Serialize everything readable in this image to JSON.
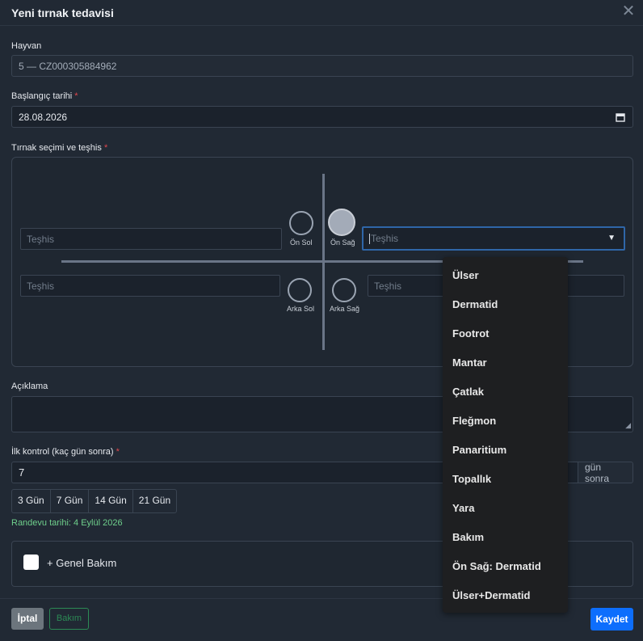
{
  "modal": {
    "title": "Yeni tırnak tedavisi",
    "close": "✕"
  },
  "animal": {
    "label": "Hayvan",
    "value": "5 — CZ000305884962"
  },
  "start_date": {
    "label": "Başlangıç tarihi",
    "required": "*",
    "value": "28.08.2026"
  },
  "hoof_section": {
    "label": "Tırnak seçimi ve teşhis",
    "required": "*",
    "diagnosis_placeholder": "Teşhis",
    "hooves": {
      "front_left": "Ön Sol",
      "front_right": "Ön Sağ",
      "rear_left": "Arka Sol",
      "rear_right": "Arka Sağ"
    },
    "selected": "front_right"
  },
  "description": {
    "label": "Açıklama",
    "value": ""
  },
  "first_check": {
    "label": "İlk kontrol (kaç gün sonra)",
    "required": "*",
    "value": "7",
    "suffix": "gün sonra",
    "quick_buttons": [
      "3 Gün",
      "7 Gün",
      "14 Gün",
      "21 Gün"
    ]
  },
  "appointment_text": "Randevu tarihi: 4 Eylül 2026",
  "general_care": {
    "label": "+ Genel Bakım",
    "checked": false
  },
  "footer": {
    "cancel": "İptal",
    "care": "Bakım",
    "save": "Kaydet"
  },
  "dropdown_options": [
    "Ülser",
    "Dermatid",
    "Footrot",
    "Mantar",
    "Çatlak",
    "Fleğmon",
    "Panaritium",
    "Topallık",
    "Yara",
    "Bakım",
    "Ön Sağ: Dermatid",
    "Ülser+Dermatid"
  ],
  "colors": {
    "accent": "#0d6efd",
    "success": "#2c8a55",
    "required": "#e0484e",
    "background": "#212934"
  }
}
